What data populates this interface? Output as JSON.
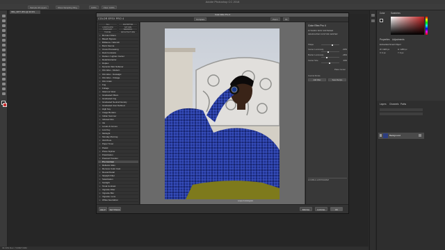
{
  "app_title": "Adobe Photoshop CC 2018",
  "document_tab": "IMG_3077.JPG @ 33.3% (RGB/8)",
  "options_bar": [
    "Sample All Layers",
    "Show Sampling Ring",
    "100%",
    "Flow: 100%"
  ],
  "dialog": {
    "title": "Color Efex Pro 4",
    "brand": "COLOR EFEX PRO 4",
    "view_btns": [
      "Compare",
      "Zoom",
      "Fit"
    ],
    "categories": [
      "ALL",
      "FAVORITES",
      "LANDSCAPE",
      "NATURE",
      "PORTRAIT",
      "WEDDING",
      "TRAVEL",
      "ARCHITECTURE"
    ],
    "filters": [
      "Bi-Color Filters",
      "Bleach Bypass",
      "Brilliance / Warmth",
      "Burnt Sienna",
      "Cross Processing",
      "Dark Contrasts",
      "Darken / Lighten Center",
      "Detail Extractor",
      "Duplex",
      "Dynamic Skin Softener",
      "Film Efex - Modern",
      "Film Efex - Nostalgic",
      "Film Efex - Vintage",
      "Film Grain",
      "Fog",
      "Foliage",
      "Glamour Glow",
      "Graduated Filters",
      "Graduated Fog",
      "Graduated Neutral Density",
      "Graduated User Defined",
      "High Key",
      "Image Borders",
      "Indian Summer",
      "Infrared Film",
      "Ink",
      "Levels & Curves",
      "Low Key",
      "Midnight",
      "Monday Morning",
      "Old Photo",
      "Paper Toner",
      "Pastel",
      "Photo Stylizer",
      "Polarization",
      "Polaroid Transfer",
      "Pro Contrast",
      "Reflector Efex",
      "Remove Color Cast",
      "Reveal Detail",
      "Skylight Filter",
      "Solarization",
      "Sunlight",
      "Tonal Contrast",
      "Vignette Filter",
      "Vignette Blur",
      "Vignette: Lens",
      "White Neutralizer"
    ],
    "selected_filter": "Pro Contrast",
    "list_footer": [
      "HISTORY",
      "BOOKMARKS"
    ],
    "bottom_left": [
      "HELP",
      "SETTINGS"
    ],
    "bottom_right": [
      "BRUSH",
      "CANCEL",
      "OK"
    ],
    "zoom_label": "Loupe & Histogram",
    "controls": {
      "title": "Color Efex Pro 4",
      "items": [
        "DYNAMIC SKIN SOFTENER",
        "GRADUATED CUSTOM CENTER"
      ],
      "section": "Control Points",
      "sliders": [
        {
          "label": "Shape",
          "value": ""
        },
        {
          "label": "Center Luminosity",
          "value": "-33%"
        },
        {
          "label": "Border Luminosity",
          "value": "-46%"
        },
        {
          "label": "Center Size",
          "value": "44%"
        }
      ],
      "place_center": "Place Center",
      "buttons": [
        "Add Filter",
        "Save Recipe"
      ],
      "footer": "LOUPE & HISTOGRAM"
    }
  },
  "right_panel": {
    "tabs_top": [
      "Color",
      "Swatches"
    ],
    "tabs_props": [
      "Properties",
      "Adjustments"
    ],
    "smart_object": "Embedded Smart Object",
    "wh": [
      "W: 1920 px",
      "H: 1280 px"
    ],
    "xy": [
      "X: 0 px",
      "Y: 0 px"
    ],
    "layers_tabs": [
      "Layers",
      "Channels",
      "Paths"
    ],
    "layer_name": "Background"
  },
  "status": "33.33%   Doc: 7.03M/7.03M"
}
